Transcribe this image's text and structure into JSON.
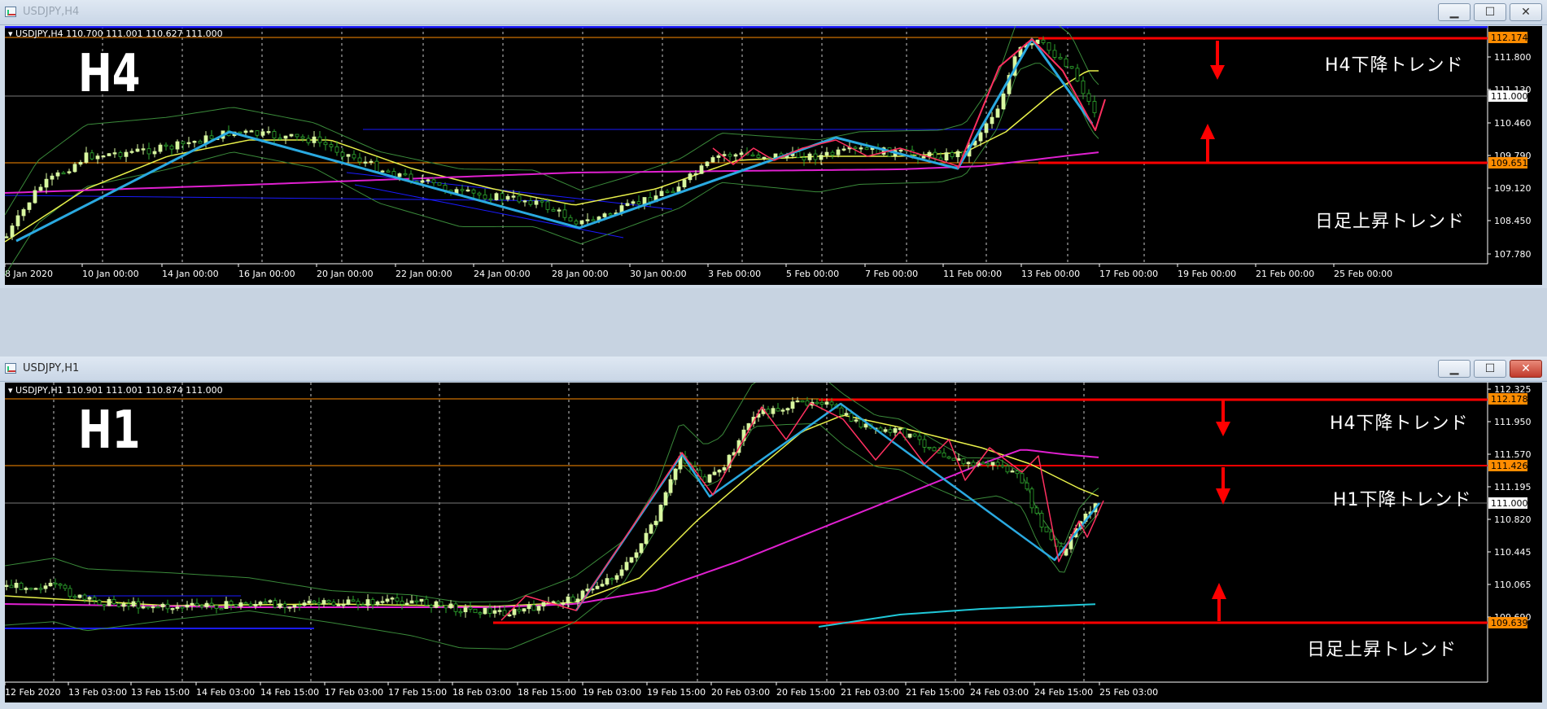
{
  "windows": {
    "h4": {
      "title": "USDJPY,H4",
      "ohlc": "USDJPY,H4  110.700 111.001 110.627 111.000",
      "big_label": "H4",
      "annotations": {
        "down": "H4下降トレンド",
        "up": "日足上昇トレンド"
      },
      "price_labels": [
        "111.800",
        "111.130",
        "110.460",
        "109.790",
        "109.120",
        "108.450",
        "107.780"
      ],
      "price_tags": {
        "resist": "112.174",
        "current": "111.000",
        "support": "109.651"
      },
      "time_labels": [
        "8 Jan 2020",
        "10 Jan 00:00",
        "14 Jan 00:00",
        "16 Jan 00:00",
        "20 Jan 00:00",
        "22 Jan 00:00",
        "24 Jan 00:00",
        "28 Jan 00:00",
        "30 Jan 00:00",
        "3 Feb 00:00",
        "5 Feb 00:00",
        "7 Feb 00:00",
        "11 Feb 00:00",
        "13 Feb 00:00",
        "17 Feb 00:00",
        "19 Feb 00:00",
        "21 Feb 00:00",
        "25 Feb 00:00"
      ]
    },
    "h1": {
      "title": "USDJPY,H1",
      "ohlc": "USDJPY,H1  110.901 111.001 110.874 111.000",
      "big_label": "H1",
      "annotations": {
        "down_h4": "H4下降トレンド",
        "down_h1": "H1下降トレンド",
        "up": "日足上昇トレンド"
      },
      "price_labels": [
        "112.325",
        "111.950",
        "111.570",
        "111.195",
        "110.820",
        "110.445",
        "110.065",
        "109.690"
      ],
      "price_tags": {
        "resist": "112.178",
        "mid": "111.426",
        "current": "111.000",
        "support": "109.639"
      },
      "time_labels": [
        "12 Feb 2020",
        "13 Feb 03:00",
        "13 Feb 15:00",
        "14 Feb 03:00",
        "14 Feb 15:00",
        "17 Feb 03:00",
        "17 Feb 15:00",
        "18 Feb 03:00",
        "18 Feb 15:00",
        "19 Feb 03:00",
        "19 Feb 15:00",
        "20 Feb 03:00",
        "20 Feb 15:00",
        "21 Feb 03:00",
        "21 Feb 15:00",
        "24 Feb 03:00",
        "24 Feb 15:00",
        "25 Feb 03:00"
      ]
    }
  },
  "colors": {
    "background": "#000000",
    "bull_candle": "#d8f7a0",
    "bear_candle": "#1a8a1a",
    "ma_fast": "#e8f04a",
    "ma_slow": "#e020d0",
    "bollinger": "#3a8a3a",
    "zigzag_major": "#2aa9e0",
    "zigzag_minor": "#ff3060",
    "horizontal_line": "#ff0000",
    "orange_line": "#ff8c00",
    "arrow": "#ff0000"
  }
}
